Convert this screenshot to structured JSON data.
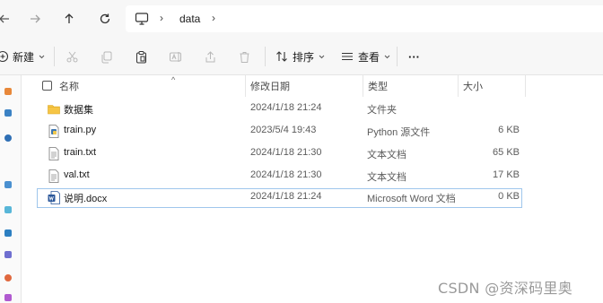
{
  "navigation": {
    "back_icon": "arrow-left-icon",
    "forward_icon": "arrow-right-icon",
    "up_icon": "arrow-up-icon",
    "refresh_icon": "refresh-icon"
  },
  "breadcrumb": {
    "root_icon": "monitor-icon",
    "items": [
      "data"
    ]
  },
  "toolbar": {
    "new_label": "新建",
    "sort_label": "排序",
    "view_label": "查看",
    "more_label": "···"
  },
  "columns": {
    "name": "名称",
    "modified": "修改日期",
    "type": "类型",
    "size": "大小"
  },
  "files": [
    {
      "name": "数据集",
      "modified": "2024/1/18 21:24",
      "type": "文件夹",
      "size": "",
      "icon": "folder-icon"
    },
    {
      "name": "train.py",
      "modified": "2023/5/4 19:43",
      "type": "Python 源文件",
      "size": "6 KB",
      "icon": "python-file-icon"
    },
    {
      "name": "train.txt",
      "modified": "2024/1/18 21:30",
      "type": "文本文档",
      "size": "65 KB",
      "icon": "text-file-icon"
    },
    {
      "name": "val.txt",
      "modified": "2024/1/18 21:30",
      "type": "文本文档",
      "size": "17 KB",
      "icon": "text-file-icon"
    },
    {
      "name": "说明.docx",
      "modified": "2024/1/18 21:24",
      "type": "Microsoft Word 文档",
      "size": "0 KB",
      "icon": "word-file-icon"
    }
  ],
  "selected_row": 4,
  "watermark": "CSDN @资深码里奥",
  "colors": {
    "folder": "#f6c545",
    "selection_border": "#9fc6ec",
    "word": "#2b579a"
  }
}
